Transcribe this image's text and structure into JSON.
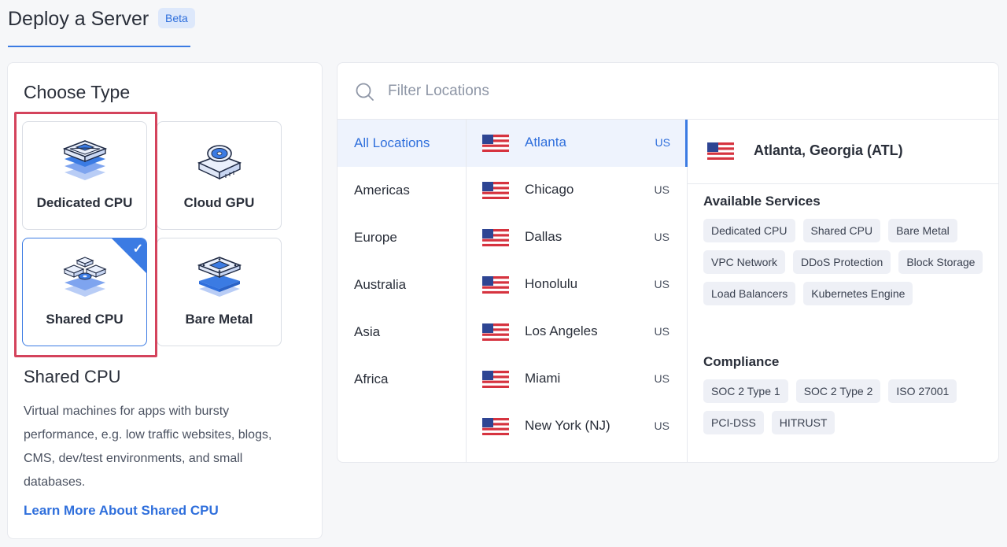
{
  "header": {
    "title": "Deploy a Server",
    "badge": "Beta"
  },
  "choose_type": {
    "title": "Choose Type",
    "tiles": [
      {
        "label": "Dedicated CPU",
        "icon": "dedicated-cpu-icon",
        "selected": false
      },
      {
        "label": "Cloud GPU",
        "icon": "cloud-gpu-icon",
        "selected": false
      },
      {
        "label": "Shared CPU",
        "icon": "shared-cpu-icon",
        "selected": true
      },
      {
        "label": "Bare Metal",
        "icon": "bare-metal-icon",
        "selected": false
      }
    ],
    "description_title": "Shared CPU",
    "description": "Virtual machines for apps with bursty performance, e.g. low traffic websites, blogs, CMS, dev/test environments, and small databases.",
    "learn_more": "Learn More About Shared CPU"
  },
  "locations": {
    "filter_placeholder": "Filter Locations",
    "regions": [
      "All Locations",
      "Americas",
      "Europe",
      "Australia",
      "Asia",
      "Africa"
    ],
    "active_region": "All Locations",
    "cities": [
      {
        "name": "Atlanta",
        "cc": "US"
      },
      {
        "name": "Chicago",
        "cc": "US"
      },
      {
        "name": "Dallas",
        "cc": "US"
      },
      {
        "name": "Honolulu",
        "cc": "US"
      },
      {
        "name": "Los Angeles",
        "cc": "US"
      },
      {
        "name": "Miami",
        "cc": "US"
      },
      {
        "name": "New York (NJ)",
        "cc": "US"
      }
    ],
    "active_city": "Atlanta"
  },
  "detail": {
    "title": "Atlanta, Georgia (ATL)",
    "services_title": "Available Services",
    "services": [
      "Dedicated CPU",
      "Shared CPU",
      "Bare Metal",
      "VPC Network",
      "DDoS Protection",
      "Block Storage",
      "Load Balancers",
      "Kubernetes Engine"
    ],
    "compliance_title": "Compliance",
    "compliance": [
      "SOC 2 Type 1",
      "SOC 2 Type 2",
      "ISO 27001",
      "PCI-DSS",
      "HITRUST"
    ]
  },
  "colors": {
    "accent": "#3b7be3",
    "highlight": "#d4435c",
    "active_bg": "#eef3fd"
  }
}
